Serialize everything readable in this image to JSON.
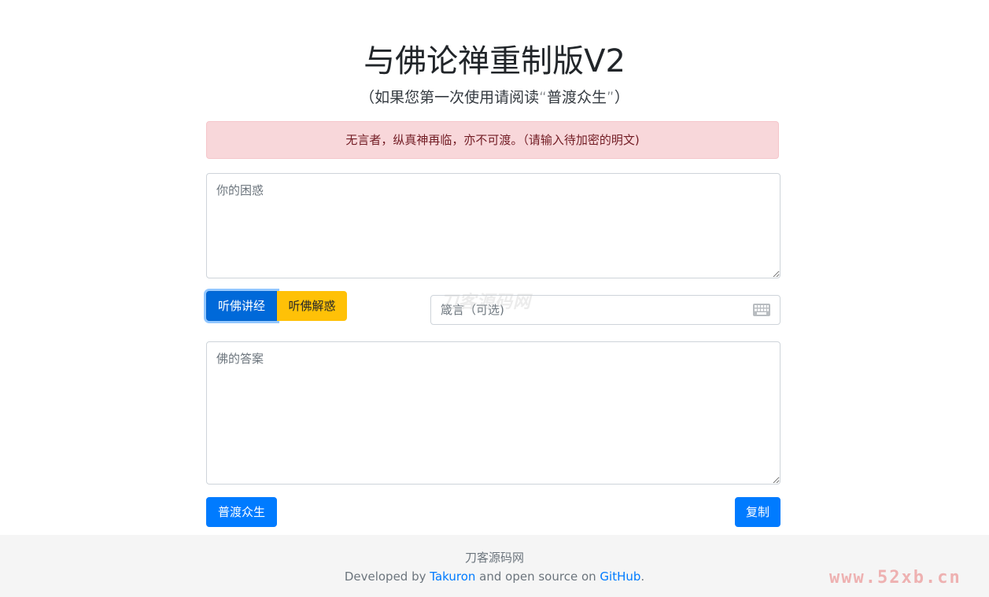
{
  "header": {
    "title": "与佛论禅重制版V2",
    "subtitle": "（如果您第一次使用请阅读“普渡众生”）"
  },
  "alert": {
    "text": "无言者，纵真神再临，亦不可渡。（请输入待加密的明文)"
  },
  "input": {
    "placeholder": "你的困惑"
  },
  "actions": {
    "encode_label": "听佛讲经",
    "decode_label": "听佛解惑"
  },
  "key": {
    "placeholder": "箴言（可选)",
    "icon": "keyboard-icon"
  },
  "output": {
    "placeholder": "佛的答案"
  },
  "bottom": {
    "help_label": "普渡众生",
    "copy_label": "复制"
  },
  "footer": {
    "site_name": "刀客源码网",
    "developed_by": "Developed by",
    "author": "Takuron",
    "and_text": "and open source on",
    "github": "GitHub",
    "period": "."
  },
  "watermarks": {
    "center": "刀客源码网",
    "corner": "www.52xb.cn"
  },
  "colors": {
    "primary": "#007bff",
    "warning": "#ffc107",
    "alert_bg": "#f8d7da",
    "alert_text": "#721c24"
  }
}
